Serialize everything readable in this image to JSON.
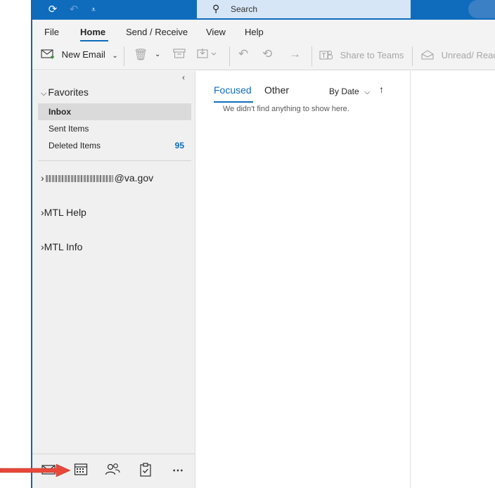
{
  "search": {
    "placeholder": "Search"
  },
  "ribbon": {
    "tabs": [
      "File",
      "Home",
      "Send / Receive",
      "View",
      "Help"
    ],
    "active_tab": "Home"
  },
  "toolbar": {
    "new_email": "New Email",
    "share_to_teams": "Share to Teams",
    "unread_read": "Unread/ Read"
  },
  "nav": {
    "collapse_glyph": "‹",
    "favorites": "Favorites",
    "items": [
      {
        "label": "Inbox",
        "count": ""
      },
      {
        "label": "Sent Items",
        "count": ""
      },
      {
        "label": "Deleted Items",
        "count": "95"
      }
    ],
    "accounts": [
      "@va.gov",
      "MTL Help",
      "MTL Info"
    ]
  },
  "list": {
    "tabs": [
      "Focused",
      "Other"
    ],
    "sort": "By Date",
    "empty_message": "We didn't find anything to show here."
  },
  "colors": {
    "accent": "#0f6cbd",
    "annotation_arrow": "#e8473a"
  },
  "icons": [
    "sync-icon",
    "undo-icon",
    "customize-icon",
    "search-icon",
    "new-email-icon",
    "delete-icon",
    "archive-icon",
    "move-icon",
    "reply-icon",
    "reply-all-icon",
    "forward-icon",
    "teams-icon",
    "envelope-open-icon",
    "mail-icon",
    "calendar-icon",
    "people-icon",
    "tasks-icon",
    "more-icon"
  ]
}
